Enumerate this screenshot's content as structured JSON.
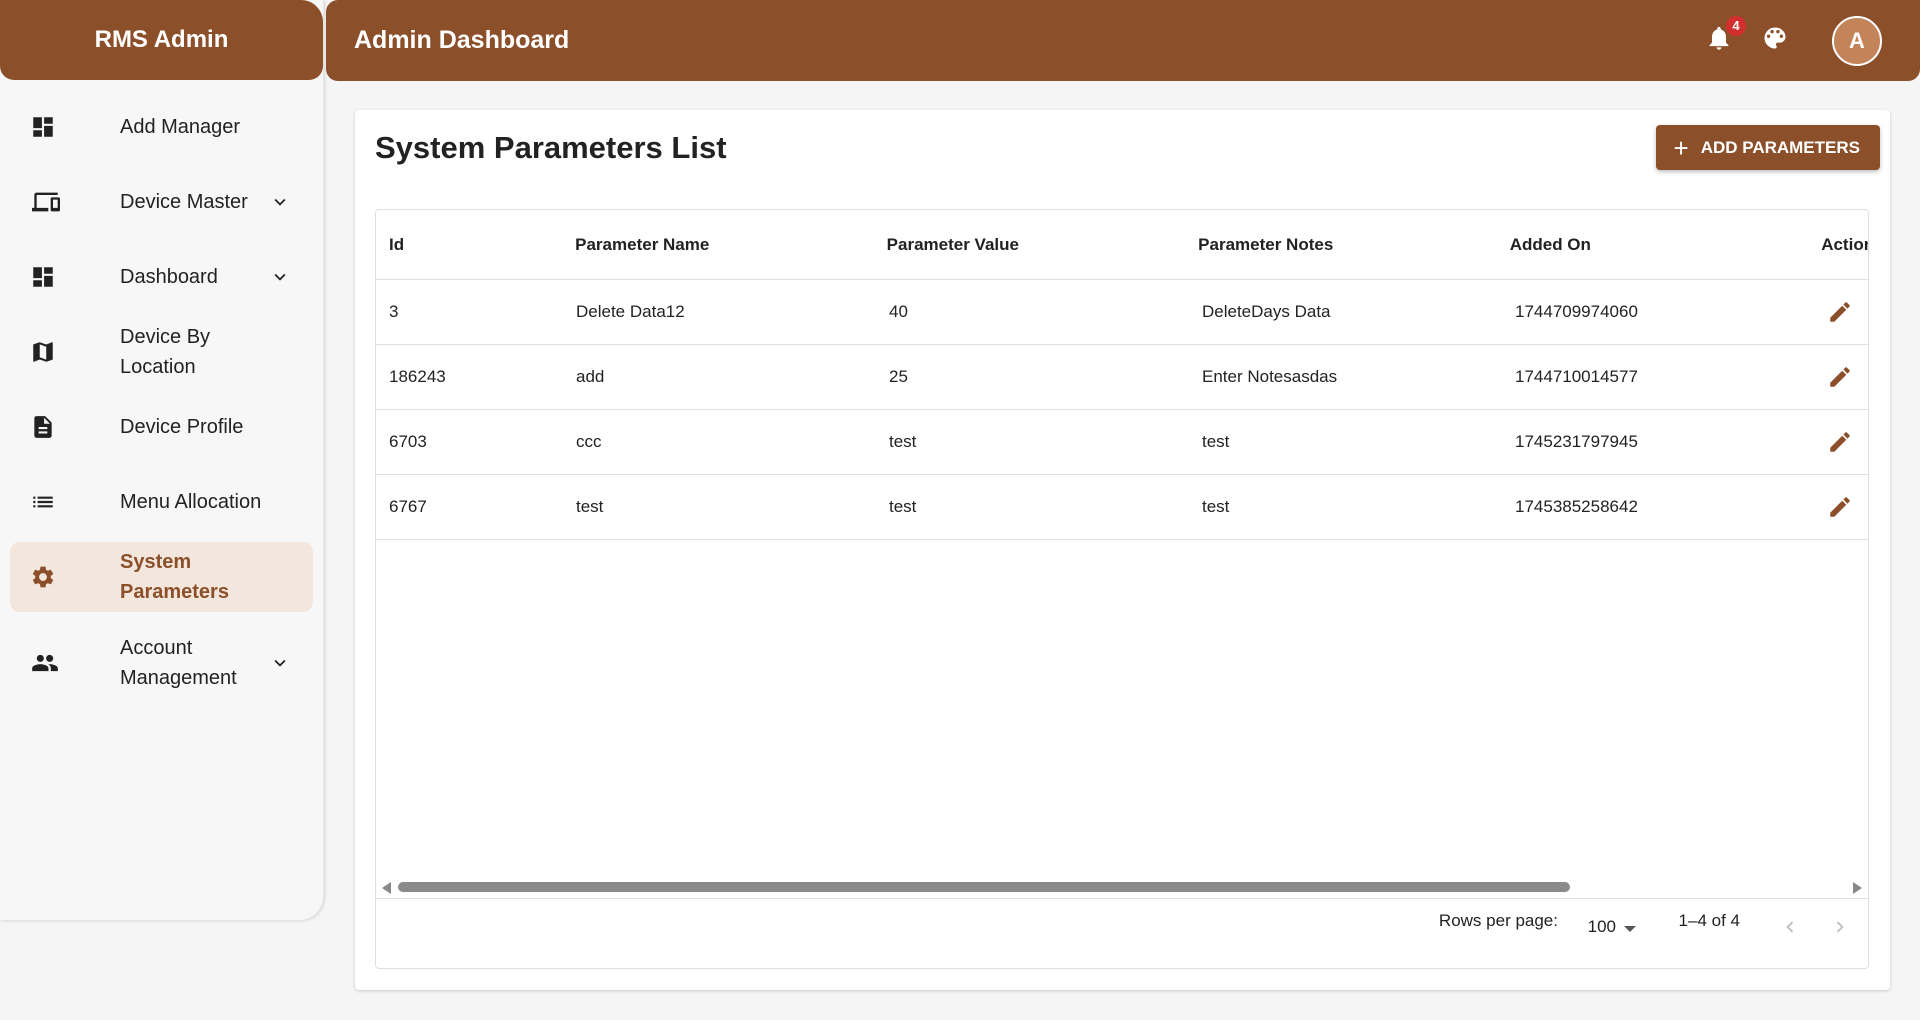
{
  "app": {
    "brand": "RMS Admin",
    "page_title": "Admin Dashboard"
  },
  "topbar": {
    "notifications_count": "4",
    "avatar_letter": "A"
  },
  "sidebar": {
    "items": [
      {
        "label": "Add Manager",
        "icon": "dashboard-icon",
        "expandable": false,
        "active": false
      },
      {
        "label": "Device Master",
        "icon": "devices-icon",
        "expandable": true,
        "active": false
      },
      {
        "label": "Dashboard",
        "icon": "dashboard-icon",
        "expandable": true,
        "active": false
      },
      {
        "label": "Device By Location",
        "icon": "map-icon",
        "expandable": false,
        "active": false
      },
      {
        "label": "Device Profile",
        "icon": "document-icon",
        "expandable": false,
        "active": false
      },
      {
        "label": "Menu Allocation",
        "icon": "list-icon",
        "expandable": false,
        "active": false
      },
      {
        "label": "System Parameters",
        "icon": "gear-icon",
        "expandable": false,
        "active": true
      },
      {
        "label": "Account Management",
        "icon": "people-icon",
        "expandable": true,
        "active": false
      }
    ]
  },
  "main": {
    "title": "System Parameters List",
    "add_button_label": "ADD PARAMETERS",
    "table": {
      "columns": [
        "Id",
        "Parameter Name",
        "Parameter Value",
        "Parameter Notes",
        "Added On",
        "Actions"
      ],
      "rows": [
        [
          "3",
          "Delete Data12",
          "40",
          "DeleteDays Data",
          "1744709974060"
        ],
        [
          "186243",
          "add",
          "25",
          "Enter Notesasdas",
          "1744710014577"
        ],
        [
          "6703",
          "ccc",
          "test",
          "test",
          "1745231797945"
        ],
        [
          "6767",
          "test",
          "test",
          "test",
          "1745385258642"
        ]
      ]
    },
    "pagination": {
      "rows_per_page_label": "Rows per page:",
      "rows_per_page_value": "100",
      "range_text": "1–4 of 4"
    }
  },
  "colors": {
    "brand": "#8b4f2a",
    "active_bg": "#f3e6dd",
    "badge": "#d32f2f"
  }
}
